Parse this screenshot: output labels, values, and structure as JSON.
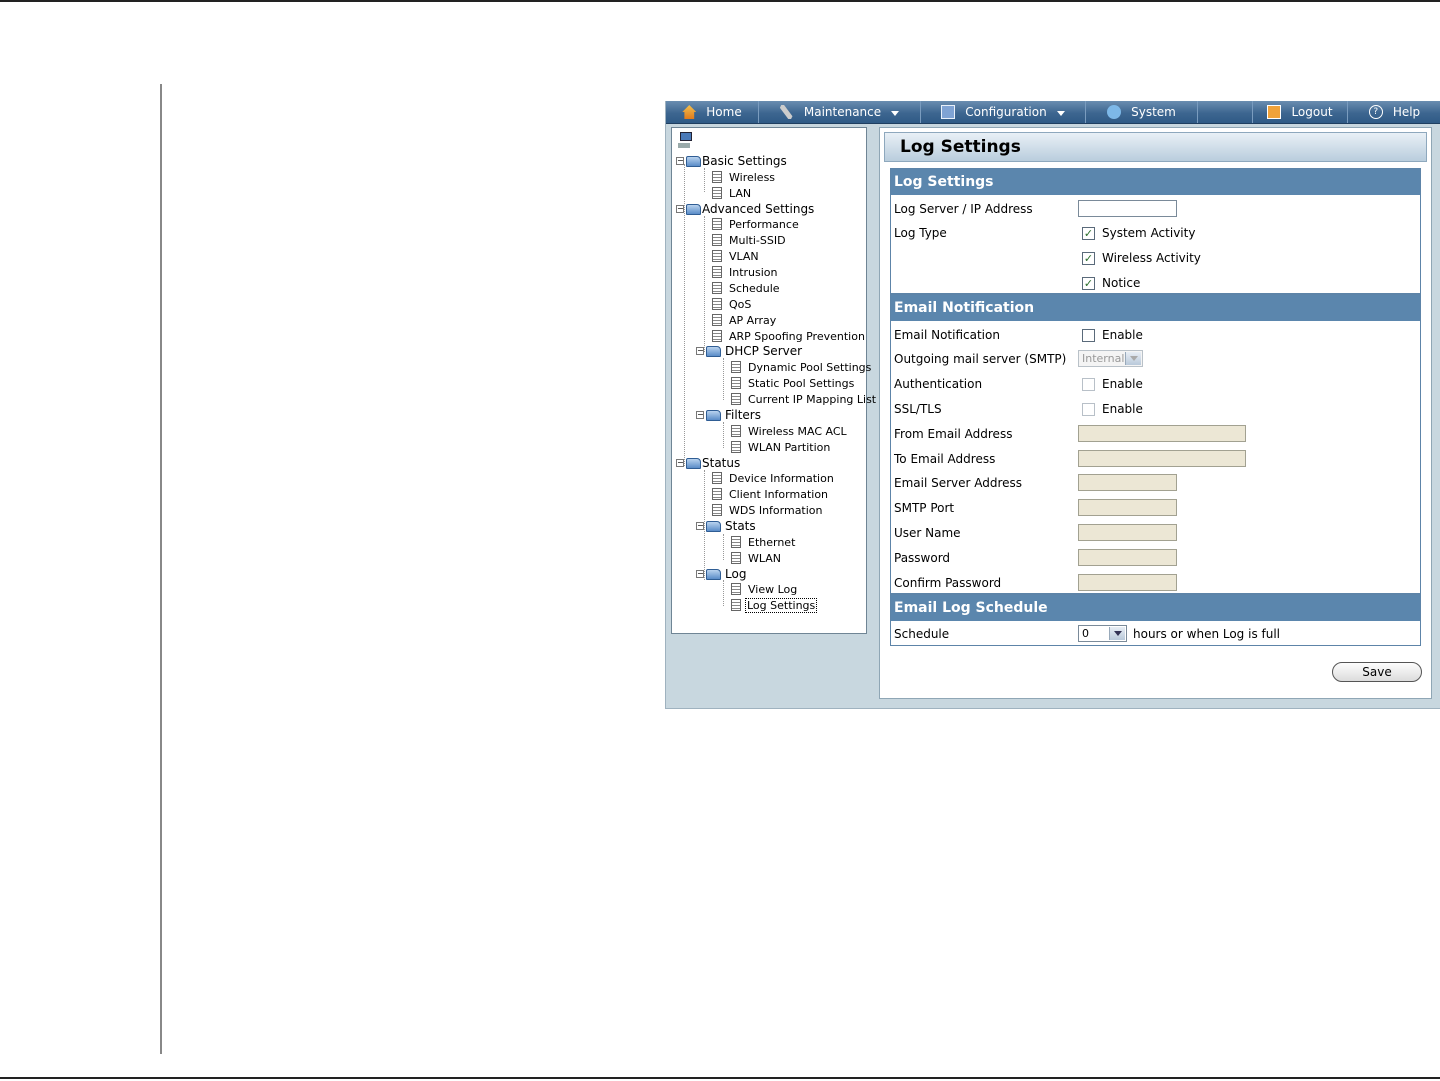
{
  "nav": {
    "home": "Home",
    "maintenance": "Maintenance",
    "configuration": "Configuration",
    "system": "System",
    "logout": "Logout",
    "help": "Help"
  },
  "tree": {
    "basic_settings": "Basic Settings",
    "wireless": "Wireless",
    "lan": "LAN",
    "advanced_settings": "Advanced Settings",
    "performance": "Performance",
    "multi_ssid": "Multi-SSID",
    "vlan": "VLAN",
    "intrusion": "Intrusion",
    "schedule": "Schedule",
    "qos": "QoS",
    "ap_array": "AP Array",
    "arp_spoofing": "ARP Spoofing Prevention",
    "dhcp_server": "DHCP Server",
    "dynamic_pool": "Dynamic Pool Settings",
    "static_pool": "Static Pool Settings",
    "current_ip": "Current IP Mapping List",
    "filters": "Filters",
    "wireless_mac_acl": "Wireless MAC ACL",
    "wlan_partition": "WLAN Partition",
    "status": "Status",
    "device_info": "Device Information",
    "client_info": "Client Information",
    "wds_info": "WDS Information",
    "stats": "Stats",
    "ethernet": "Ethernet",
    "wlan": "WLAN",
    "log": "Log",
    "view_log": "View Log",
    "log_settings": "Log Settings"
  },
  "content": {
    "title": "Log Settings",
    "log_section": {
      "header": "Log Settings",
      "server_label": "Log Server / IP Address",
      "server_value": "",
      "log_type_label": "Log Type",
      "system_activity": "System Activity",
      "wireless_activity": "Wireless Activity",
      "notice": "Notice"
    },
    "email_section": {
      "header": "Email Notification",
      "email_notification_label": "Email Notification",
      "enable": "Enable",
      "smtp_label": "Outgoing mail server (SMTP)",
      "smtp_value": "Internal",
      "auth_label": "Authentication",
      "ssl_label": "SSL/TLS",
      "from_label": "From Email Address",
      "to_label": "To Email Address",
      "server_label": "Email Server Address",
      "port_label": "SMTP Port",
      "user_label": "User Name",
      "password_label": "Password",
      "confirm_label": "Confirm Password"
    },
    "schedule_section": {
      "header": "Email Log Schedule",
      "schedule_label": "Schedule",
      "schedule_value": "0",
      "schedule_suffix": "hours or when Log is full"
    },
    "save": "Save"
  },
  "checkboxes": {
    "system_activity": true,
    "wireless_activity": true,
    "notice": true,
    "email_notification": false,
    "authentication": false,
    "ssl_tls": false
  }
}
